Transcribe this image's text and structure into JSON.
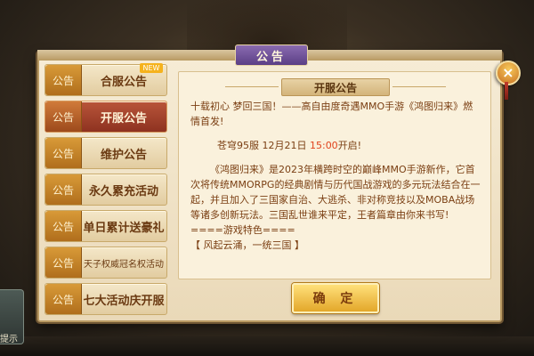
{
  "dialog": {
    "title": "公告",
    "close_icon": "×"
  },
  "tabs": [
    {
      "badge": "公告",
      "label": "合服公告",
      "new_tag": "NEW",
      "active": false
    },
    {
      "badge": "公告",
      "label": "开服公告",
      "active": true
    },
    {
      "badge": "公告",
      "label": "维护公告",
      "active": false
    },
    {
      "badge": "公告",
      "label": "永久累充活动",
      "active": false
    },
    {
      "badge": "公告",
      "label": "单日累计送豪礼",
      "active": false
    },
    {
      "badge": "公告",
      "label": "天子权威冠名权活动",
      "active": false
    },
    {
      "badge": "公告",
      "label": "七大活动庆开服",
      "active": false
    }
  ],
  "content": {
    "header": "开服公告",
    "intro": "十载初心 梦回三国！——高自由度奇遇MMO手游《鸿图归来》燃情首发!",
    "server_line_prefix": "苍穹95服 12月21日 ",
    "server_time": "15:00",
    "server_line_suffix": "开启!",
    "description": "《鸿图归来》是2023年横跨时空的巅峰MMO手游新作，它首次将传统MMORPG的经典剧情与历代国战游戏的多元玩法结合在一起，并且加入了三国家自治、大逃杀、非对称竞技以及MOBA战场等诸多创新玩法。三国乱世谁来平定，王者篇章由你来书写!",
    "features_heading": "====游戏特色====",
    "feature_1": "【 风起云涌，一统三国 】"
  },
  "confirm_button": "确 定",
  "left_hint": "提示"
}
